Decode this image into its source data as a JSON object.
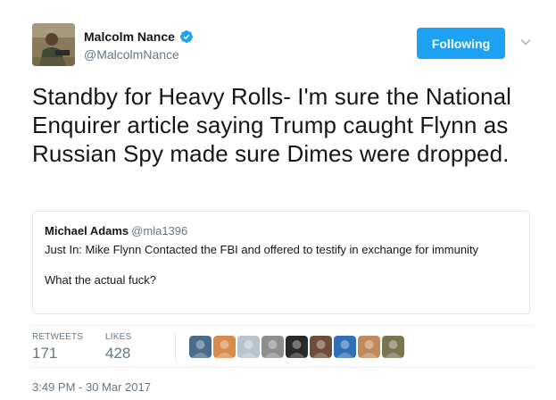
{
  "author": {
    "name": "Malcolm Nance",
    "handle": "@MalcolmNance",
    "verified": true,
    "avatar_icon": "author-avatar-photo"
  },
  "follow_button": {
    "label": "Following"
  },
  "tweet": {
    "text": "Standby for Heavy Rolls- I'm sure the National Enquirer article saying Trump caught Flynn as Russian Spy made sure Dimes were dropped."
  },
  "quoted_tweet": {
    "name": "Michael Adams",
    "handle": "@mla1396",
    "paragraph1": "Just In: Mike Flynn Contacted the FBI and offered to testify in exchange for immunity",
    "paragraph2": "What the actual fuck?"
  },
  "stats": {
    "retweets_label": "RETWEETS",
    "retweets_value": "171",
    "likes_label": "LIKES",
    "likes_value": "428"
  },
  "likers": [
    {
      "icon": "liker-avatar-1",
      "color": "#4a6b8a"
    },
    {
      "icon": "liker-avatar-2",
      "color": "#d98b4b"
    },
    {
      "icon": "liker-avatar-3",
      "color": "#b8c3cc"
    },
    {
      "icon": "liker-avatar-4",
      "color": "#8e8e8e"
    },
    {
      "icon": "liker-avatar-5",
      "color": "#2a2a2a"
    },
    {
      "icon": "liker-avatar-6",
      "color": "#6e4e3a"
    },
    {
      "icon": "liker-avatar-7",
      "color": "#2f6fb5"
    },
    {
      "icon": "liker-avatar-8",
      "color": "#c28a5a"
    },
    {
      "icon": "liker-avatar-9",
      "color": "#7a7450"
    }
  ],
  "timestamp": "3:49 PM - 30 Mar 2017",
  "colors": {
    "accent": "#1da1f2",
    "text": "#14171a",
    "muted": "#657786",
    "border": "#e1e8ed"
  }
}
